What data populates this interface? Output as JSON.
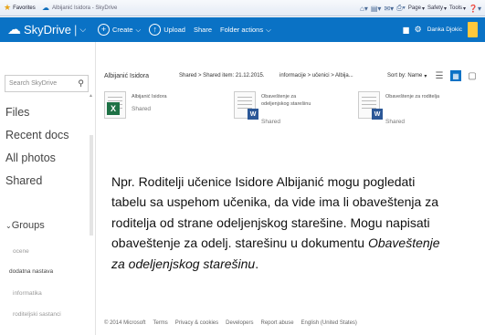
{
  "browser": {
    "favorites_label": "Favorites",
    "tab_title": "Albijanić Isidora - SkyDrive",
    "tools": [
      "Page",
      "Safety",
      "Tools"
    ]
  },
  "header": {
    "brand": "SkyDrive",
    "commands": {
      "create": "Create",
      "upload": "Upload",
      "share": "Share",
      "folder_actions": "Folder actions"
    },
    "user_name": "Danka Djokic",
    "accent_color": "#0a72c5"
  },
  "sidebar": {
    "search_placeholder": "Search SkyDrive",
    "nav": [
      "Files",
      "Recent docs",
      "All photos",
      "Shared"
    ],
    "groups_label": "Groups",
    "groups": [
      "ocene",
      "dodatna nastava",
      "informatika",
      "roditeljski sastanci"
    ]
  },
  "main": {
    "folder_title": "Albijanić Isidora",
    "shared_crumb": "Shared > Shared item: 21.12.2015.",
    "path_crumb": "informacije > učenici > Albija...",
    "sort_label": "Sort by: Name",
    "files": [
      {
        "name": "Albijanić Isidora",
        "state": "Shared",
        "icon": "excel-icon"
      },
      {
        "name": "Obaveštenje za odeljenjskog starešinu",
        "state": "Shared",
        "icon": "word-icon"
      },
      {
        "name": "Obaveštenje za roditelja",
        "state": "Shared",
        "icon": "word-icon"
      }
    ]
  },
  "overlay": {
    "text": "Npr. Roditelji učenice Isidore Albijanić mogu pogledati tabelu sa uspehom učenika, da vide ima li obaveštenja za roditelja od strane odeljenjskog starešine. Mogu napisati obaveštenje za odelj. starešinu u dokumentu",
    "italic_text": "Obaveštenje za odeljenjskog starešinu",
    "end_punct": "."
  },
  "footer": [
    "© 2014 Microsoft",
    "Terms",
    "Privacy & cookies",
    "Developers",
    "Report abuse",
    "English (United States)"
  ]
}
